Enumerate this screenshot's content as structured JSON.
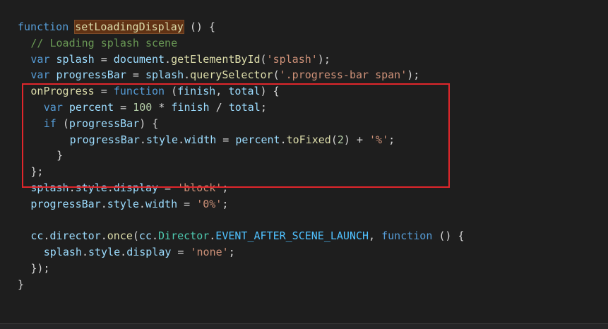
{
  "code": {
    "l1": {
      "kw": "function",
      "fn": "setLoadingDisplay",
      "rest": " () {"
    },
    "l2": {
      "comment": "// Loading splash scene"
    },
    "l3": {
      "kw": "var",
      "v": "splash",
      "eq": " = ",
      "obj": "document",
      "dot": ".",
      "fn": "getElementById",
      "open": "(",
      "str": "'splash'",
      "close": ");"
    },
    "l4": {
      "kw": "var",
      "v": "progressBar",
      "eq": " = ",
      "obj": "splash",
      "dot": ".",
      "fn": "querySelector",
      "open": "(",
      "str": "'.progress-bar span'",
      "close": ");"
    },
    "l5": {
      "fn": "onProgress",
      "eq": " = ",
      "kw": "function",
      "open": " (",
      "p1": "finish",
      "comma": ", ",
      "p2": "total",
      "close": ") {"
    },
    "l6": {
      "kw": "var",
      "v": "percent",
      "eq": " = ",
      "num": "100",
      "op": " * ",
      "a": "finish",
      "op2": " / ",
      "b": "total",
      "end": ";"
    },
    "l7": {
      "kw": "if",
      "open": " (",
      "v": "progressBar",
      "close": ") {"
    },
    "l8": {
      "a": "progressBar",
      "d1": ".",
      "b": "style",
      "d2": ".",
      "c": "width",
      "eq": " = ",
      "e": "percent",
      "d3": ".",
      "fn": "toFixed",
      "open": "(",
      "num": "2",
      "mid": ") + ",
      "str": "'%'",
      "end": ";"
    },
    "l9": {
      "text": "}"
    },
    "l10": {
      "text": "};"
    },
    "l11": {
      "a": "splash",
      "d1": ".",
      "b": "style",
      "d2": ".",
      "c": "display",
      "eq": " = ",
      "str": "'block'",
      "end": ";"
    },
    "l12": {
      "a": "progressBar",
      "d1": ".",
      "b": "style",
      "d2": ".",
      "c": "width",
      "eq": " = ",
      "str": "'0%'",
      "end": ";"
    },
    "l14": {
      "a": "cc",
      "d1": ".",
      "b": "director",
      "d2": ".",
      "fn": "once",
      "open": "(",
      "c": "cc",
      "d3": ".",
      "cls": "Director",
      "d4": ".",
      "const": "EVENT_AFTER_SCENE_LAUNCH",
      "comma": ", ",
      "kw": "function",
      "rest": " () {"
    },
    "l15": {
      "a": "splash",
      "d1": ".",
      "b": "style",
      "d2": ".",
      "c": "display",
      "eq": " = ",
      "str": "'none'",
      "end": ";"
    },
    "l16": {
      "text": "});"
    },
    "l17": {
      "text": "}"
    }
  },
  "colors": {
    "keyword": "#569cd6",
    "function": "#dcdcaa",
    "variable": "#9cdcfe",
    "class": "#4ec9b0",
    "constant": "#4fc1ff",
    "string": "#ce9178",
    "number": "#b5cea8",
    "comment": "#6a9955",
    "highlight_box": "#e0262b"
  }
}
